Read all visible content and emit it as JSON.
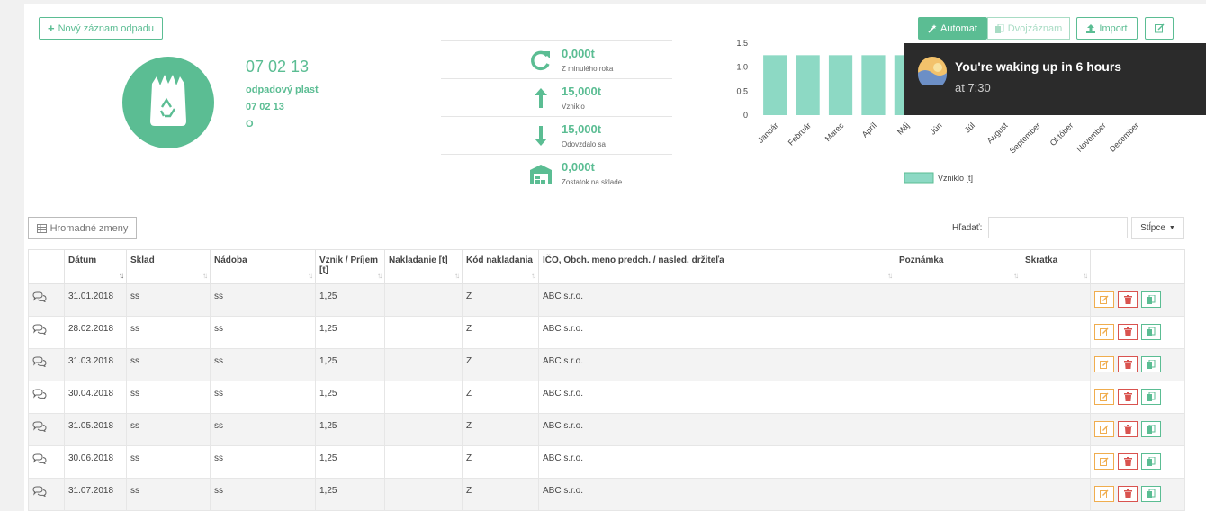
{
  "toolbar": {
    "new_record": "Nový záznam odpadu",
    "automat": "Automat",
    "dvojzaznam": "Dvojzáznam",
    "import": "Import"
  },
  "waste": {
    "code": "07 02 13",
    "name": "odpadový plast",
    "code2": "07 02 13",
    "category": "O"
  },
  "stats": [
    {
      "value": "0,000t",
      "label": "Z minulého roka",
      "icon": "refresh-icon"
    },
    {
      "value": "15,000t",
      "label": "Vzniklo",
      "icon": "arrow-up-icon"
    },
    {
      "value": "15,000t",
      "label": "Odovzdalo sa",
      "icon": "arrow-down-icon"
    },
    {
      "value": "0,000t",
      "label": "Zostatok na sklade",
      "icon": "warehouse-icon"
    }
  ],
  "chart_data": {
    "type": "bar",
    "categories": [
      "Január",
      "Február",
      "Marec",
      "Apríl",
      "Máj",
      "Jún",
      "Júl",
      "August",
      "September",
      "Október",
      "November",
      "December"
    ],
    "series": [
      {
        "name": "Vzniklo [t]",
        "values": [
          1.25,
          1.25,
          1.25,
          1.25,
          1.25,
          1.25,
          1.25,
          1.25,
          1.25,
          1.25,
          1.25,
          1.25
        ]
      }
    ],
    "ylim": [
      0,
      1.5
    ],
    "yticks": [
      "0",
      "0.5",
      "1.0",
      "1.5"
    ],
    "legend": "bottom",
    "color": "#8dd9c4"
  },
  "toast": {
    "title": "You're waking up in 6 hours",
    "subtitle": "at 7:30"
  },
  "bulk_button": "Hromadné zmeny",
  "search": {
    "label": "Hľadať:",
    "value": ""
  },
  "columns_button": "Stĺpce",
  "table": {
    "headers": [
      "Dátum",
      "Sklad",
      "Nádoba",
      "Vznik / Príjem [t]",
      "Nakladanie [t]",
      "Kód nakladania",
      "IČO, Obch. meno predch. / nasled. držiteľa",
      "Poznámka",
      "Skratka"
    ],
    "rows": [
      {
        "date": "31.01.2018",
        "sklad": "ss",
        "nadoba": "ss",
        "vznik": "1,25",
        "nakladanie": "",
        "kod": "Z",
        "ico": "ABC s.r.o.",
        "poznamka": "",
        "skratka": ""
      },
      {
        "date": "28.02.2018",
        "sklad": "ss",
        "nadoba": "ss",
        "vznik": "1,25",
        "nakladanie": "",
        "kod": "Z",
        "ico": "ABC s.r.o.",
        "poznamka": "",
        "skratka": ""
      },
      {
        "date": "31.03.2018",
        "sklad": "ss",
        "nadoba": "ss",
        "vznik": "1,25",
        "nakladanie": "",
        "kod": "Z",
        "ico": "ABC s.r.o.",
        "poznamka": "",
        "skratka": ""
      },
      {
        "date": "30.04.2018",
        "sklad": "ss",
        "nadoba": "ss",
        "vznik": "1,25",
        "nakladanie": "",
        "kod": "Z",
        "ico": "ABC s.r.o.",
        "poznamka": "",
        "skratka": ""
      },
      {
        "date": "31.05.2018",
        "sklad": "ss",
        "nadoba": "ss",
        "vznik": "1,25",
        "nakladanie": "",
        "kod": "Z",
        "ico": "ABC s.r.o.",
        "poznamka": "",
        "skratka": ""
      },
      {
        "date": "30.06.2018",
        "sklad": "ss",
        "nadoba": "ss",
        "vznik": "1,25",
        "nakladanie": "",
        "kod": "Z",
        "ico": "ABC s.r.o.",
        "poznamka": "",
        "skratka": ""
      },
      {
        "date": "31.07.2018",
        "sklad": "ss",
        "nadoba": "ss",
        "vznik": "1,25",
        "nakladanie": "",
        "kod": "Z",
        "ico": "ABC s.r.o.",
        "poznamka": "",
        "skratka": ""
      }
    ]
  }
}
